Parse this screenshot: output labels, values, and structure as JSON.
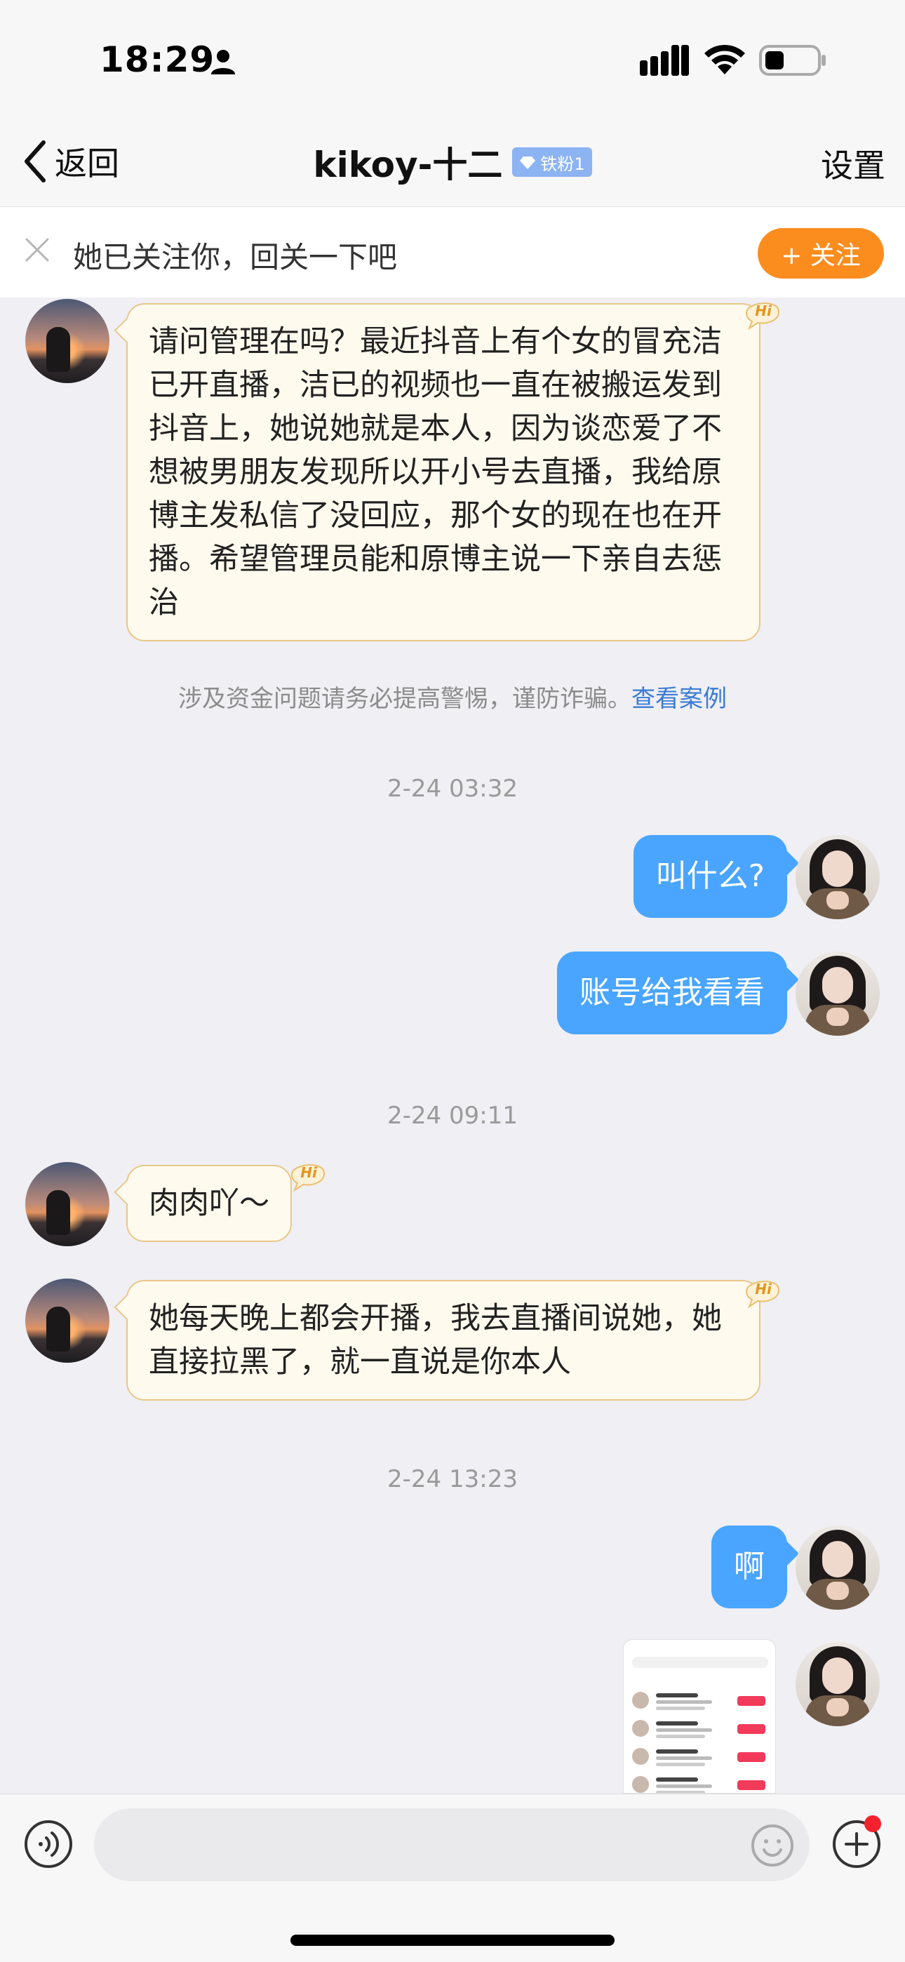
{
  "status_bar": {
    "time": "18:29"
  },
  "nav": {
    "back_label": "返回",
    "title": "kikoy-十二",
    "badge": "铁粉1",
    "settings_label": "设置"
  },
  "banner": {
    "text": "她已关注你，回关一下吧",
    "follow_label": "+ 关注"
  },
  "messages": [
    {
      "sender": "other",
      "text": "请问管理在吗？最近抖音上有个女的冒充洁已开直播，洁已的视频也一直在被搬运发到抖音上，她说她就是本人，因为谈恋爱了不想被男朋友发现所以开小号去直播，我给原博主发私信了没回应，那个女的现在也在开播。希望管理员能和原博主说一下亲自去惩治"
    },
    {
      "sender": "me",
      "text": "叫什么?"
    },
    {
      "sender": "me",
      "text": "账号给我看看"
    },
    {
      "sender": "other",
      "text": "肉肉吖～"
    },
    {
      "sender": "other",
      "text": "她每天晚上都会开播，我去直播间说她，她直接拉黑了，就一直说是你本人"
    },
    {
      "sender": "me",
      "text": "啊"
    }
  ],
  "notice": {
    "text": "涉及资金问题请务必提高警惕，谨防诈骗。",
    "link": "查看案例"
  },
  "timestamps": [
    "2-24 03:32",
    "2-24 09:11",
    "2-24 13:23"
  ],
  "hi_badge_text": "Hi",
  "input": {
    "placeholder": ""
  },
  "colors": {
    "outgoing_bubble": "#49a5ff",
    "incoming_bubble": "#fffaee",
    "incoming_border": "#e9c789",
    "follow_button": "#fb8c1e",
    "link": "#3a7bd5",
    "badge": "#8cb3f2"
  }
}
